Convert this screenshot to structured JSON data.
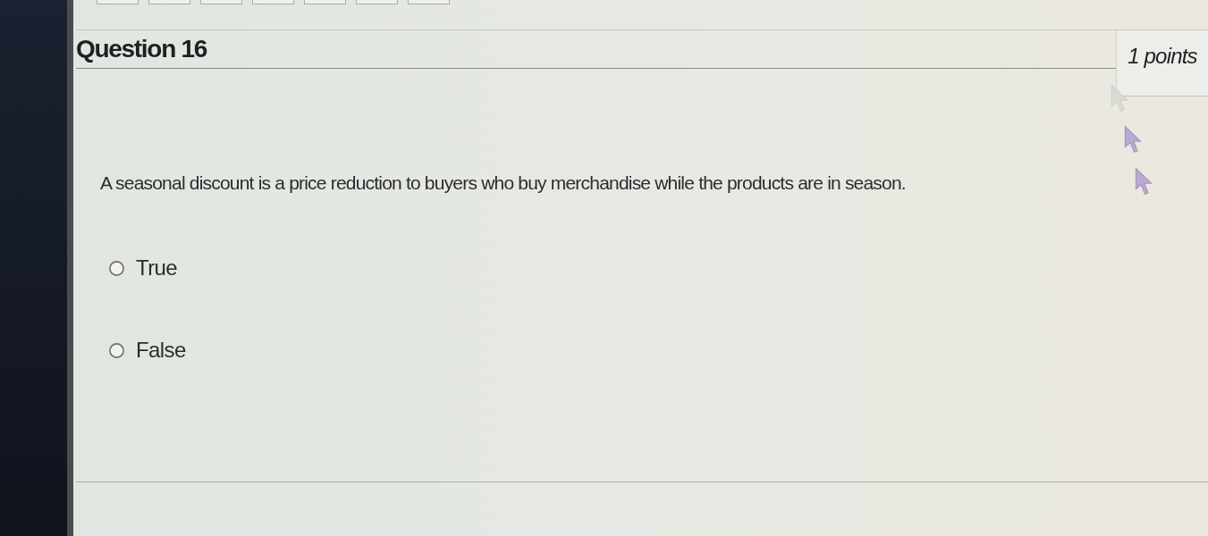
{
  "question": {
    "title": "Question 16",
    "points": "1 points",
    "text": "A seasonal discount is a price reduction to buyers who buy merchandise while the products are in season.",
    "options": [
      {
        "label": "True",
        "selected": false
      },
      {
        "label": "False",
        "selected": false
      }
    ]
  }
}
